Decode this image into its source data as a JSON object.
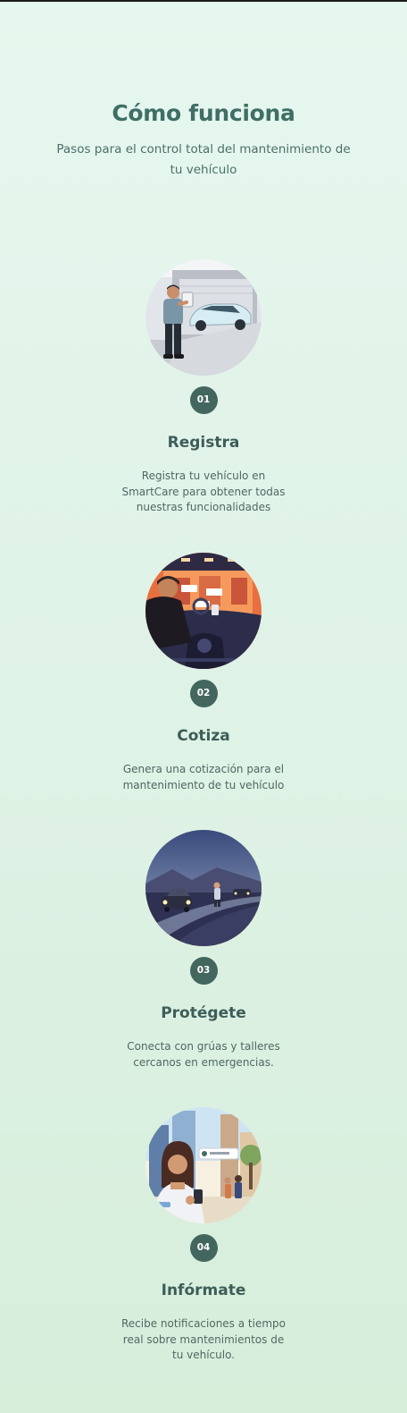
{
  "section": {
    "title": "Cómo funciona",
    "subtitle": "Pasos para el control total del mantenimiento de tu vehículo"
  },
  "steps": [
    {
      "number": "01",
      "title": "Registra",
      "description": "Registra tu vehículo en SmartCare para obtener todas nuestras funcionalidades",
      "illustration": "person-registering-car-illustration"
    },
    {
      "number": "02",
      "title": "Cotiza",
      "description": "Genera una cotización para el mantenimiento de tu vehículo",
      "illustration": "driver-dashboard-illustration"
    },
    {
      "number": "03",
      "title": "Protégete",
      "description": "Conecta con grúas y talleres cercanos en emergencias.",
      "illustration": "roadside-emergency-illustration"
    },
    {
      "number": "04",
      "title": "Infórmate",
      "description": "Recibe notificaciones a tiempo real sobre mantenimientos de tu vehículo.",
      "illustration": "woman-notification-illustration"
    }
  ],
  "colors": {
    "accent": "#43665f",
    "title": "#3f6e66",
    "background": "#e3f5ea"
  }
}
